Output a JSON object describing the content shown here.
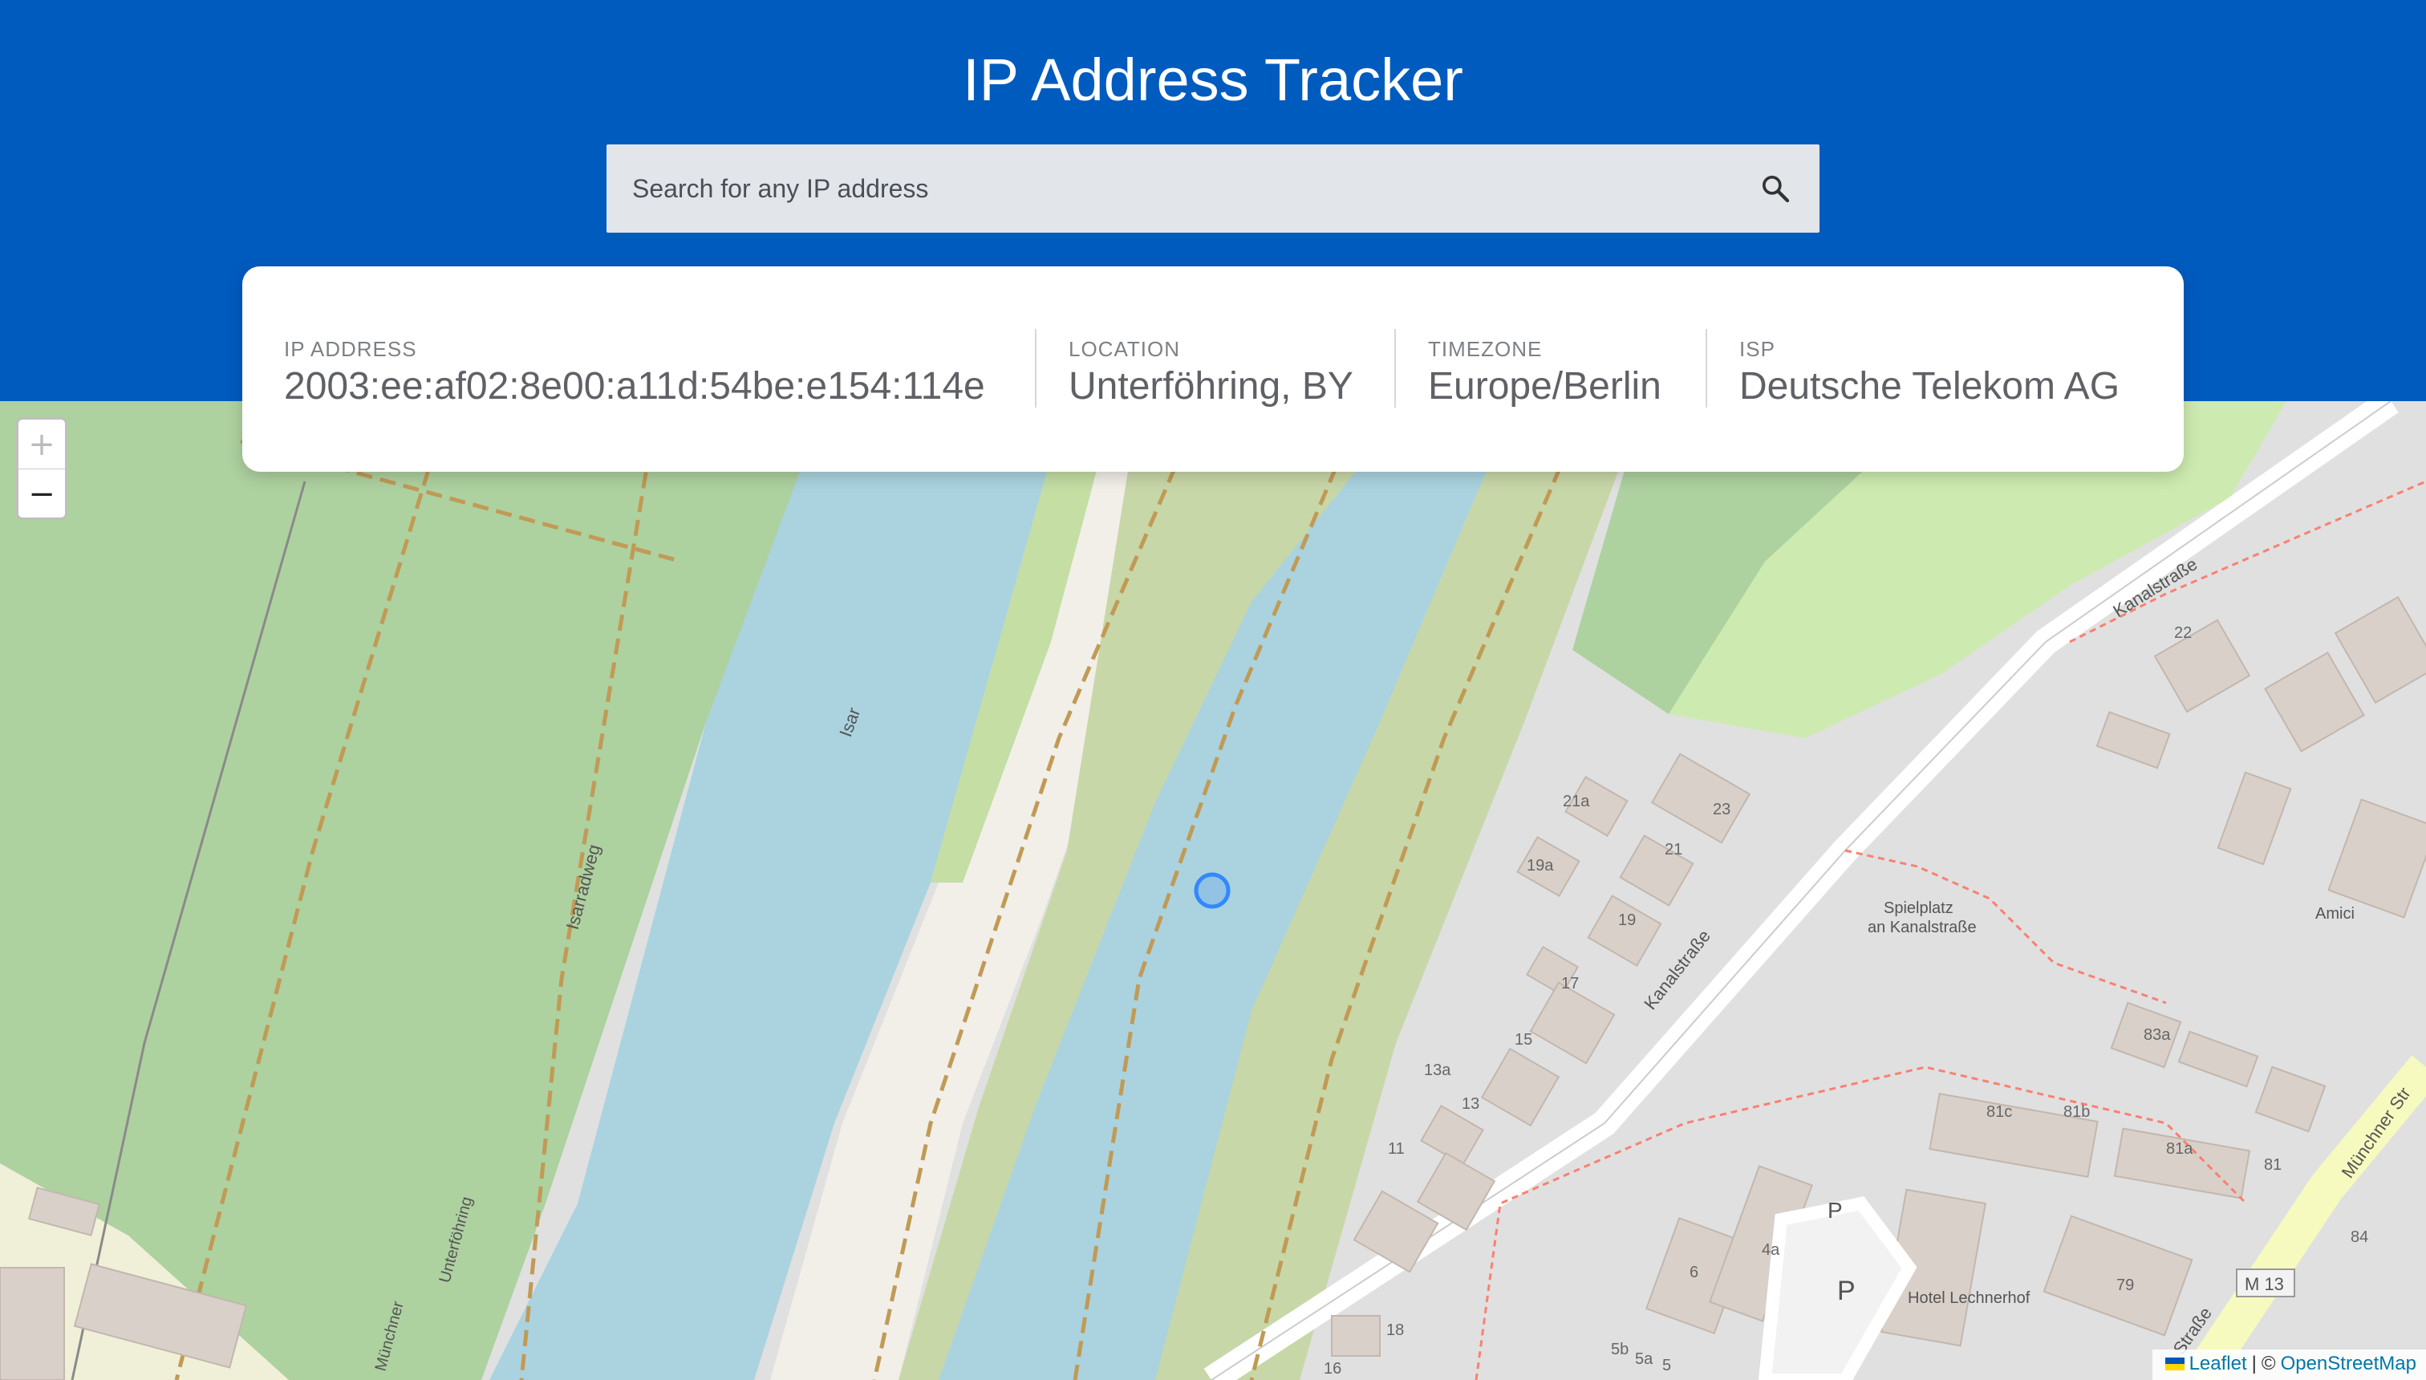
{
  "header": {
    "title": "IP Address Tracker",
    "background_color": "#005bbf"
  },
  "search": {
    "placeholder": "Search for any IP address",
    "value": "",
    "icon": "search-icon"
  },
  "info": {
    "ip": {
      "label": "IP ADDRESS",
      "value": "2003:ee:af02:8e00:a11d:54be:e154:114e"
    },
    "location": {
      "label": "LOCATION",
      "value": "Unterföhring, BY"
    },
    "timezone": {
      "label": "TIMEZONE",
      "value": "Europe/Berlin"
    },
    "isp": {
      "label": "ISP",
      "value": "Deutsche Telekom AG"
    }
  },
  "map": {
    "zoom_in": "+",
    "zoom_out": "−",
    "labels": {
      "river": "Isar",
      "path1": "Isarradweg",
      "path2": "Unterföhring",
      "street1": "Kanalstraße",
      "street2": "Kanalstraße",
      "street3": "Münchner Straße",
      "street4": "Münchner",
      "playground1": "Spielplatz",
      "playground2": "an Kanalstraße",
      "hotel": "Hotel Lechnerhof",
      "restaurant": "Amici",
      "route": "M 13",
      "parking": "P"
    },
    "house_numbers": [
      "22",
      "23",
      "21a",
      "21",
      "19a",
      "19",
      "17",
      "15",
      "13a",
      "13",
      "11",
      "83a",
      "81c",
      "81b",
      "81a",
      "81",
      "79",
      "84",
      "4a",
      "6",
      "18",
      "16",
      "5b",
      "5a",
      "5"
    ],
    "marker_color": "#3388ff"
  },
  "attribution": {
    "leaflet": "Leaflet",
    "separator": "|",
    "copyright": "©",
    "osm": "OpenStreetMap"
  }
}
